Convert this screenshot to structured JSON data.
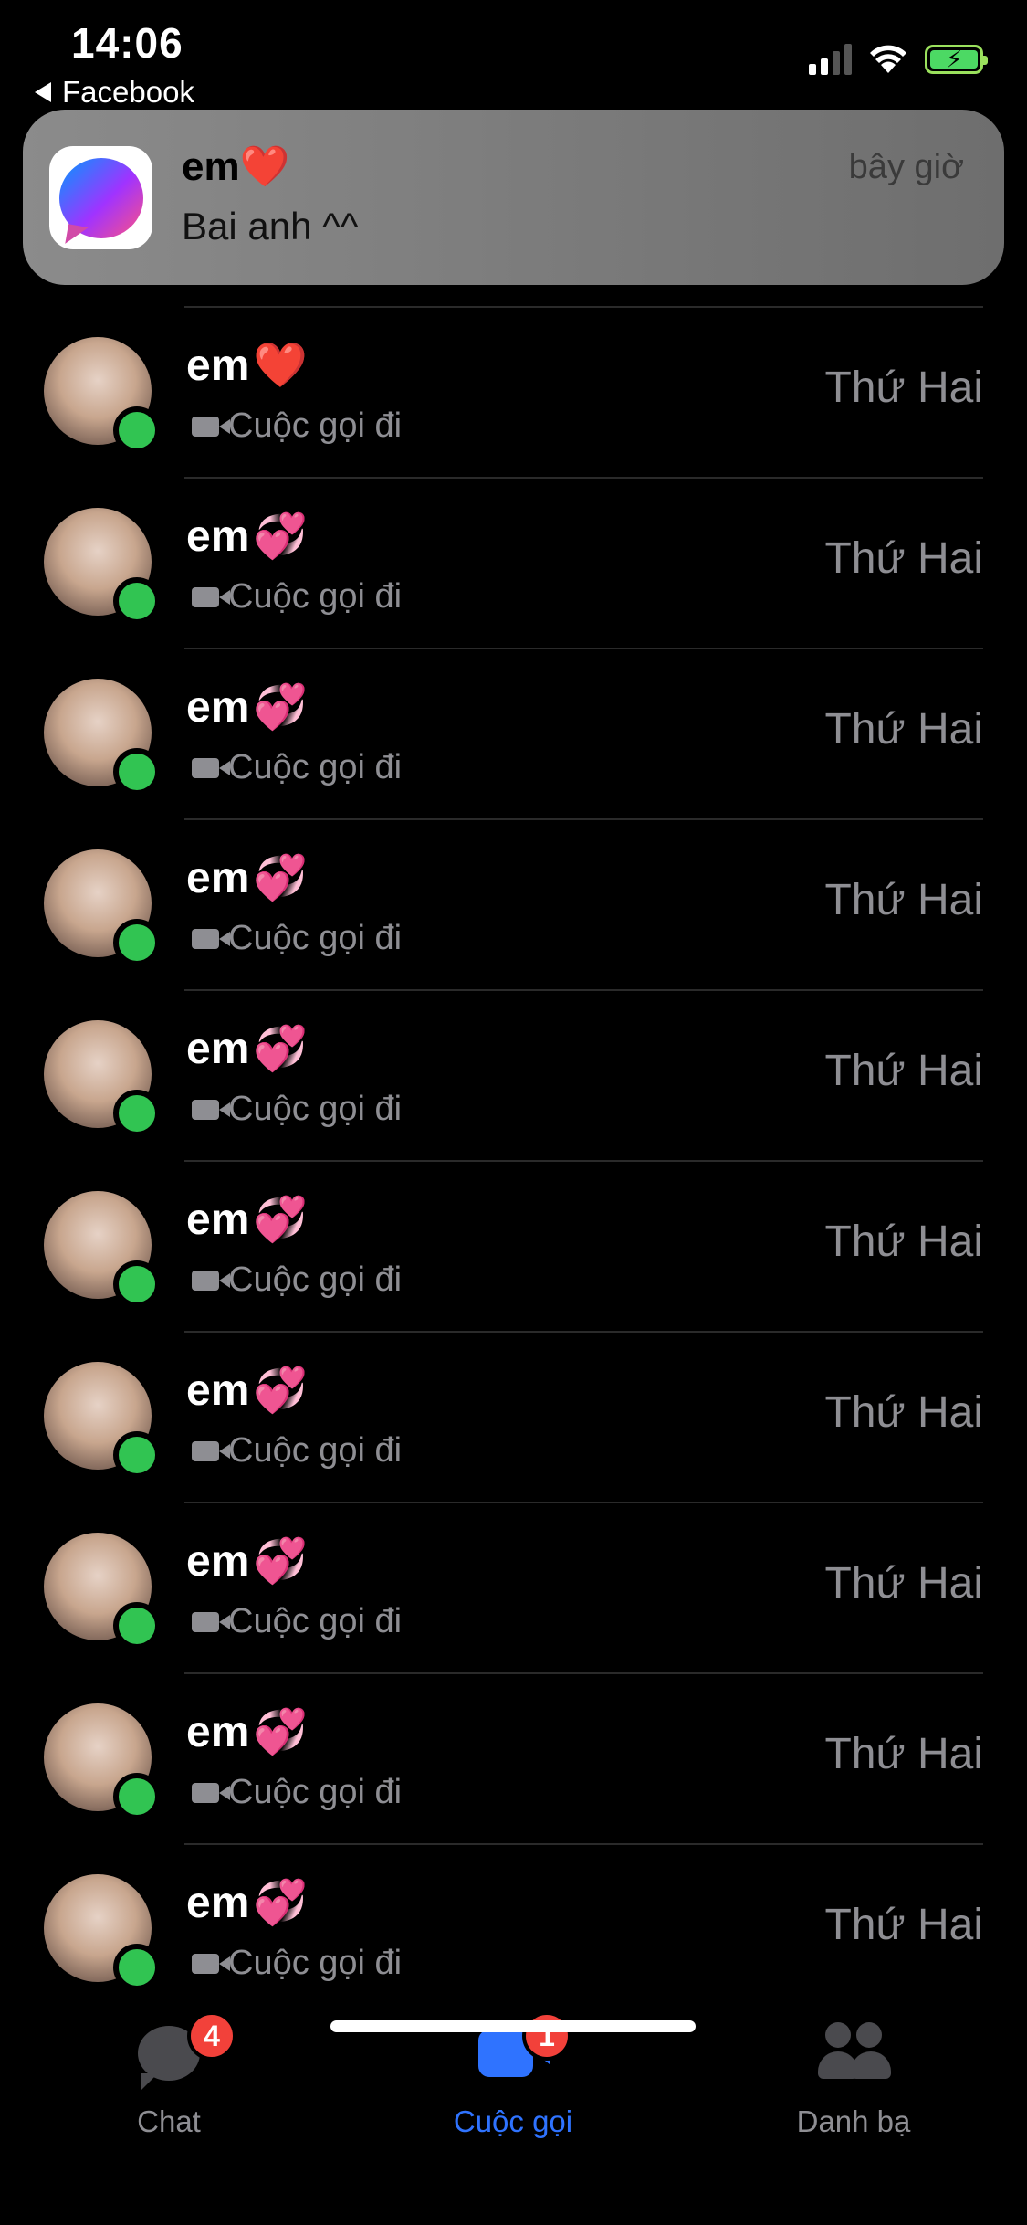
{
  "status_bar": {
    "time": "14:06",
    "back_label": "Facebook"
  },
  "notification": {
    "title": "em",
    "title_emoji": "❤️",
    "message": "Bai anh ^^",
    "time": "bây giờ"
  },
  "calls": [
    {
      "name": "em",
      "emoji": "❤️",
      "subtitle": "Cuộc gọi đi",
      "day": "Thứ Hai"
    },
    {
      "name": "em",
      "emoji": "💞",
      "subtitle": "Cuộc gọi đi",
      "day": "Thứ Hai"
    },
    {
      "name": "em",
      "emoji": "💞",
      "subtitle": "Cuộc gọi đi",
      "day": "Thứ Hai"
    },
    {
      "name": "em",
      "emoji": "💞",
      "subtitle": "Cuộc gọi đi",
      "day": "Thứ Hai"
    },
    {
      "name": "em",
      "emoji": "💞",
      "subtitle": "Cuộc gọi đi",
      "day": "Thứ Hai"
    },
    {
      "name": "em",
      "emoji": "💞",
      "subtitle": "Cuộc gọi đi",
      "day": "Thứ Hai"
    },
    {
      "name": "em",
      "emoji": "💞",
      "subtitle": "Cuộc gọi đi",
      "day": "Thứ Hai"
    },
    {
      "name": "em",
      "emoji": "💞",
      "subtitle": "Cuộc gọi đi",
      "day": "Thứ Hai"
    },
    {
      "name": "em",
      "emoji": "💞",
      "subtitle": "Cuộc gọi đi",
      "day": "Thứ Hai"
    },
    {
      "name": "em",
      "emoji": "💞",
      "subtitle": "Cuộc gọi đi",
      "day": "Thứ Hai"
    }
  ],
  "tabs": [
    {
      "label": "Chat",
      "badge": "4",
      "icon": "chat-bubble-icon",
      "active": false
    },
    {
      "label": "Cuộc gọi",
      "badge": "1",
      "icon": "video-camera-icon",
      "active": true
    },
    {
      "label": "Danh bạ",
      "badge": "",
      "icon": "people-icon",
      "active": false
    }
  ],
  "colors": {
    "active_tab": "#2F73FF",
    "inactive_tab": "#8E8E93",
    "online": "#31C452",
    "badge": "#F2413A"
  }
}
